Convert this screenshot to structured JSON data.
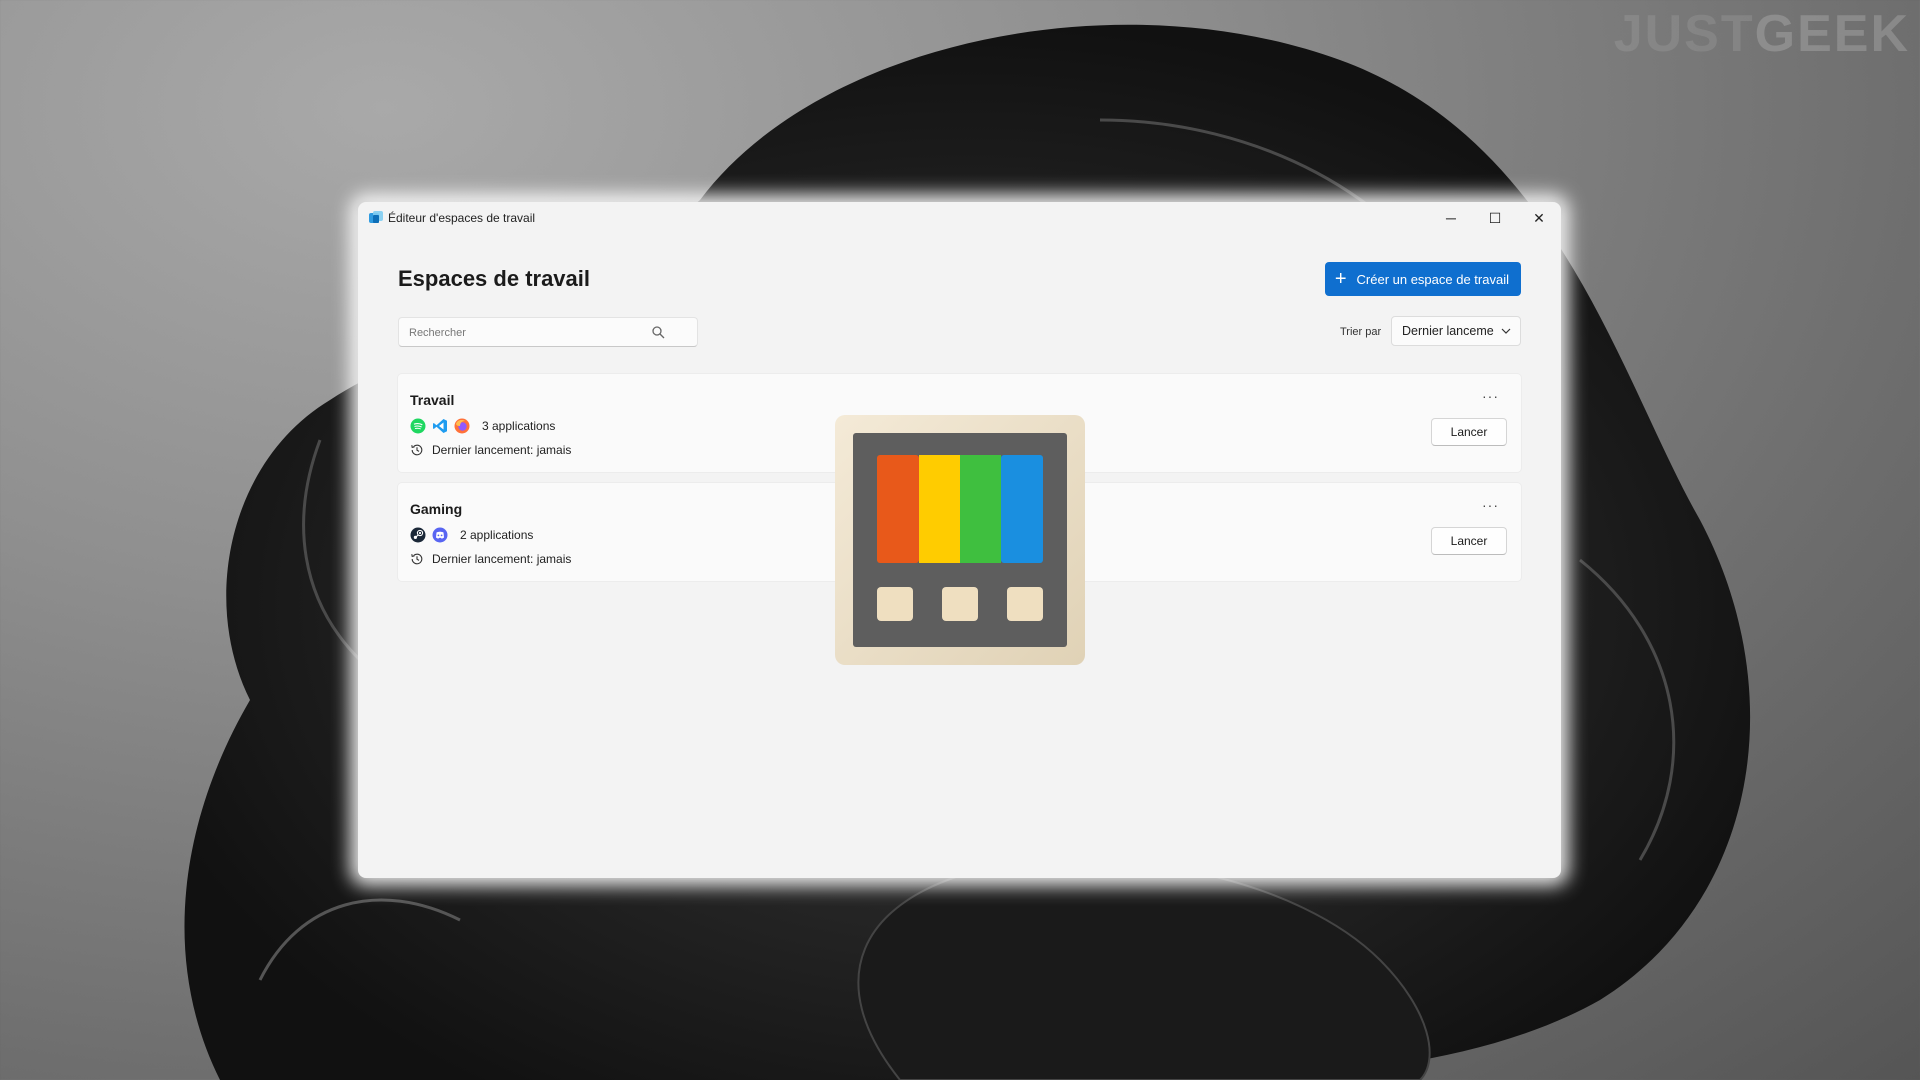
{
  "watermark": {
    "part1": "JUST",
    "part2": "GEEK"
  },
  "window": {
    "title": "Éditeur d'espaces de travail",
    "controls": {
      "minimize": "─",
      "maximize": "☐",
      "close": "✕"
    }
  },
  "header": {
    "title": "Espaces de travail",
    "create_button": "Créer un espace de travail",
    "create_icon": "plus-icon"
  },
  "search": {
    "placeholder": "Rechercher",
    "value": ""
  },
  "sort": {
    "label": "Trier par",
    "selected": "Dernier lancement"
  },
  "workspaces": [
    {
      "name": "Travail",
      "apps": [
        "spotify-icon",
        "vscode-icon",
        "firefox-icon"
      ],
      "apps_count": "3 applications",
      "last_launch": "Dernier lancement: jamais",
      "more": "···",
      "launch": "Lancer"
    },
    {
      "name": "Gaming",
      "apps": [
        "steam-icon",
        "discord-icon"
      ],
      "apps_count": "2 applications",
      "last_launch": "Dernier lancement: jamais",
      "more": "···",
      "launch": "Lancer"
    }
  ],
  "colors": {
    "accent": "#0f6fcf",
    "window_bg": "#f3f3f3",
    "card_bg": "#fafafa",
    "logo_orange": "#e8591a",
    "logo_yellow": "#ffcc00",
    "logo_green": "#3fbf3f",
    "logo_blue": "#1a8fe0"
  }
}
